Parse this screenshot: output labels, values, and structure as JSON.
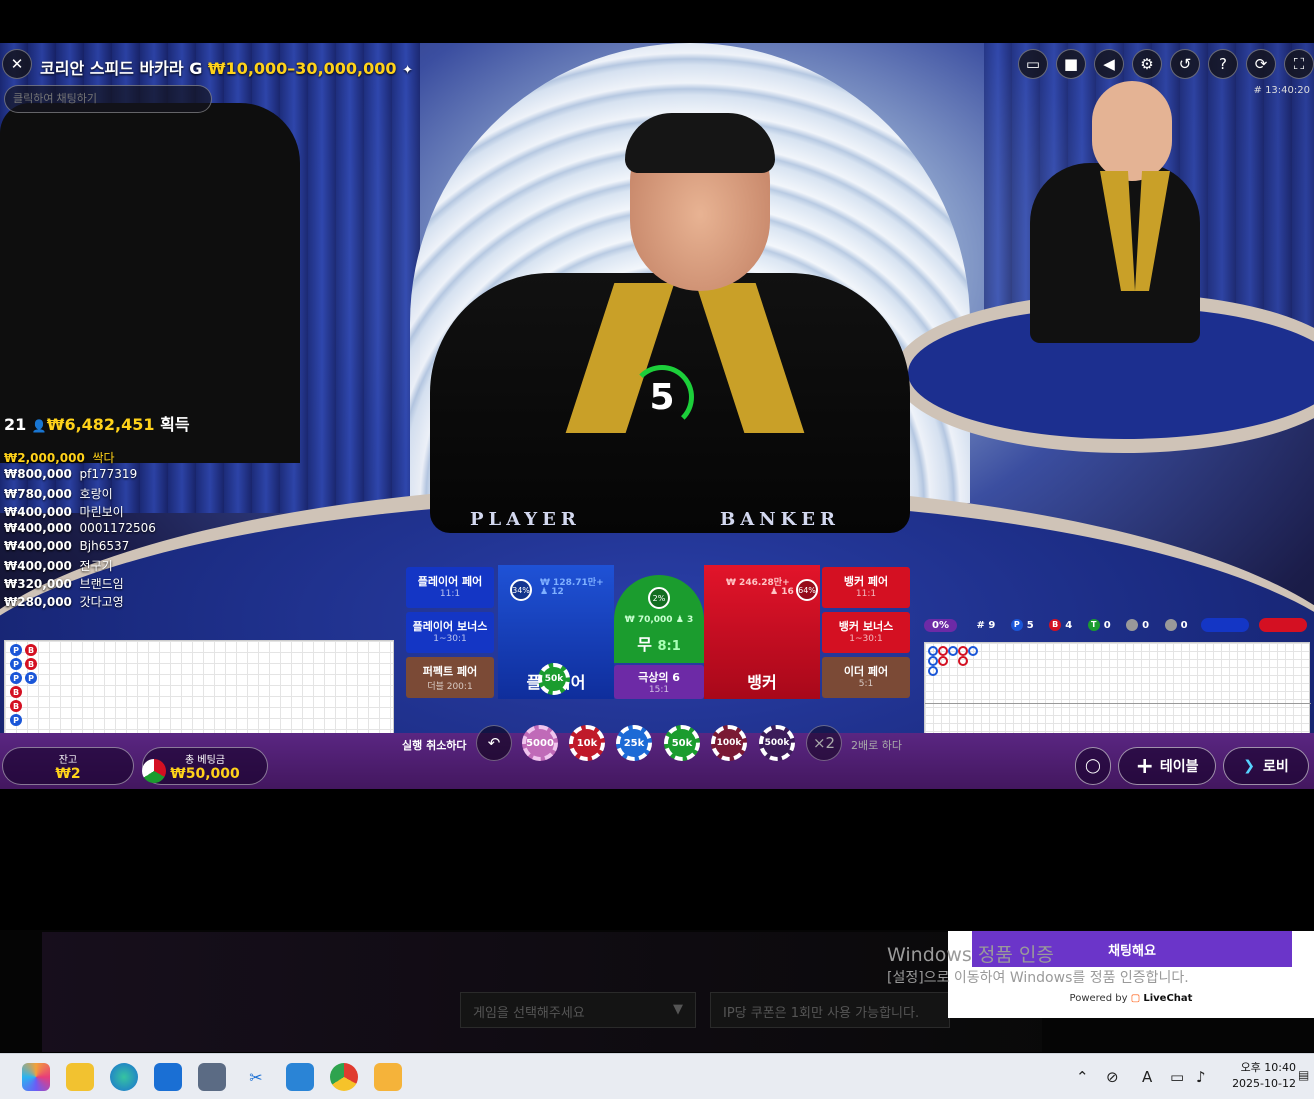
{
  "header": {
    "title": "코리안 스피드 바카라 G",
    "limit": "₩10,000–30,000,000",
    "chat_placeholder": "클릭하여 채팅하기",
    "timestamp": "# 13:40:20"
  },
  "timer": {
    "value": "5"
  },
  "table_text": {
    "player": "PLAYER",
    "banker": "BANKER"
  },
  "winners": {
    "count": "21",
    "total": "₩6,482,451",
    "suffix": "획득",
    "rows": [
      {
        "amount": "₩2,000,000",
        "name": "싹다"
      },
      {
        "amount": "₩800,000",
        "name": "pf177319"
      },
      {
        "amount": "₩780,000",
        "name": "호랑이"
      },
      {
        "amount": "₩400,000",
        "name": "마린보이"
      },
      {
        "amount": "₩400,000",
        "name": "0001172506"
      },
      {
        "amount": "₩400,000",
        "name": "Bjh6537"
      },
      {
        "amount": "₩400,000",
        "name": "전구기"
      },
      {
        "amount": "₩320,000",
        "name": "브랜드임"
      },
      {
        "amount": "₩280,000",
        "name": "갓다고영"
      }
    ]
  },
  "bets": {
    "player_pair": {
      "label": "플레이어 페어",
      "odds": "11:1"
    },
    "player_bonus": {
      "label": "플레이어 보너스",
      "odds": "1~30:1"
    },
    "perfect_pair": {
      "label": "퍼펙트 페어",
      "odds": "더블 200:1"
    },
    "banker_pair": {
      "label": "뱅커 페어",
      "odds": "11:1"
    },
    "banker_bonus": {
      "label": "뱅커 보너스",
      "odds": "1~30:1"
    },
    "either_pair": {
      "label": "이더 페어",
      "odds": "5:1"
    },
    "player": {
      "label": "플레이어",
      "amount": "₩ 128.71만+",
      "players": "12",
      "pct": "34%"
    },
    "banker": {
      "label": "뱅커",
      "amount": "₩ 246.28만+",
      "players": "16",
      "pct": "64%"
    },
    "tie": {
      "label": "무",
      "odds": "8:1",
      "amount": "₩ 70,000",
      "players": "3",
      "pct": "2%"
    },
    "super6": {
      "label": "극상의 6",
      "odds": "15:1"
    },
    "placed_chip": "50k"
  },
  "controls": {
    "undo_label": "실행 취소하다",
    "double_symbol": "×2",
    "double_label": "2배로 하다",
    "chips": [
      "5000",
      "10k",
      "25k",
      "50k",
      "100k",
      "500k"
    ],
    "balance_label": "잔고",
    "balance_value": "₩2",
    "total_bet_label": "총 베팅금",
    "total_bet_value": "₩50,000",
    "table_button": "테이블",
    "lobby_button": "로비"
  },
  "stats": {
    "pct": "0%",
    "rounds": "# 9",
    "player": "5",
    "banker": "4",
    "tie": "0",
    "player_pair": "0",
    "banker_pair": "0"
  },
  "bead_road": [
    "P",
    "B",
    "P",
    "B",
    "P",
    "P",
    "B",
    "B",
    "P"
  ],
  "desktop": {
    "select_game": "게임을 선택해주세요",
    "coupon_note": "IP당 쿠폰은 1회만 사용 가능합니다.",
    "win_line1_a": "Windows",
    "win_line1_b": "정품 인증",
    "win_line2": "[설정]으로 이동하여 Windows를 정품 인증합니다.",
    "livechat_title": "채팅해요",
    "powered_by": "Powered by",
    "livechat_brand": "LiveChat"
  },
  "taskbar": {
    "time": "오후 10:40",
    "date": "2025-10-12",
    "ime": "A"
  },
  "colors": {
    "player_blue": "#1436c5",
    "banker_red": "#d41022",
    "tie_green": "#1b9c2e",
    "gold": "#ffd21a",
    "purple_bar": "#5a2682"
  }
}
